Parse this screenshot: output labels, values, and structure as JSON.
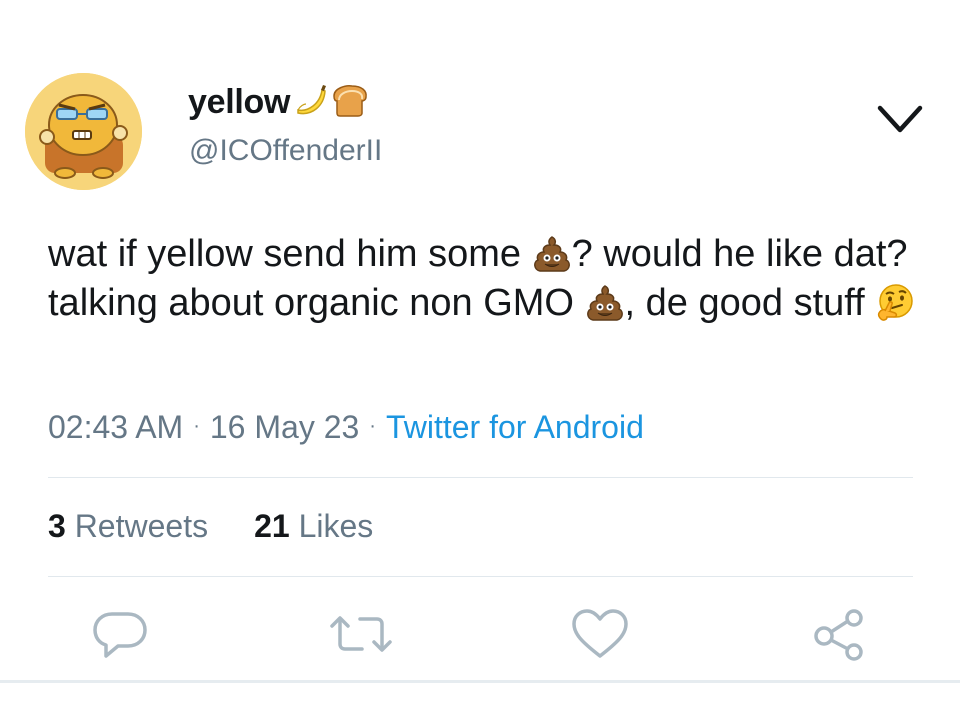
{
  "author": {
    "display_name": "yellow",
    "name_emojis": [
      "banana-emoji",
      "bread-emoji"
    ],
    "handle": "@ICOffenderII",
    "avatar": "avatar-cartoon-yellow-character"
  },
  "menu": {
    "icon": "chevron-down-icon"
  },
  "tweet": {
    "segments": [
      {
        "type": "text",
        "value": "wat if yellow send him some "
      },
      {
        "type": "emoji",
        "name": "pile-of-poo-emoji"
      },
      {
        "type": "text",
        "value": "? would he like dat? talking about organic non GMO "
      },
      {
        "type": "emoji",
        "name": "pile-of-poo-emoji"
      },
      {
        "type": "text",
        "value": ", de good stuff "
      },
      {
        "type": "emoji",
        "name": "thinking-face-emoji"
      }
    ]
  },
  "meta": {
    "time": "02:43 AM",
    "separator": "·",
    "date": "16 May 23",
    "source": "Twitter for Android"
  },
  "stats": {
    "retweets_count": "3",
    "retweets_label": "Retweets",
    "likes_count": "21",
    "likes_label": "Likes"
  },
  "actions": [
    {
      "name": "reply-icon"
    },
    {
      "name": "retweet-icon"
    },
    {
      "name": "like-icon"
    },
    {
      "name": "share-icon"
    }
  ],
  "colors": {
    "text_primary": "#14171a",
    "text_secondary": "#657786",
    "link": "#1b95e0",
    "action_icon": "#aab8c2",
    "divider": "#e1e8ed"
  }
}
